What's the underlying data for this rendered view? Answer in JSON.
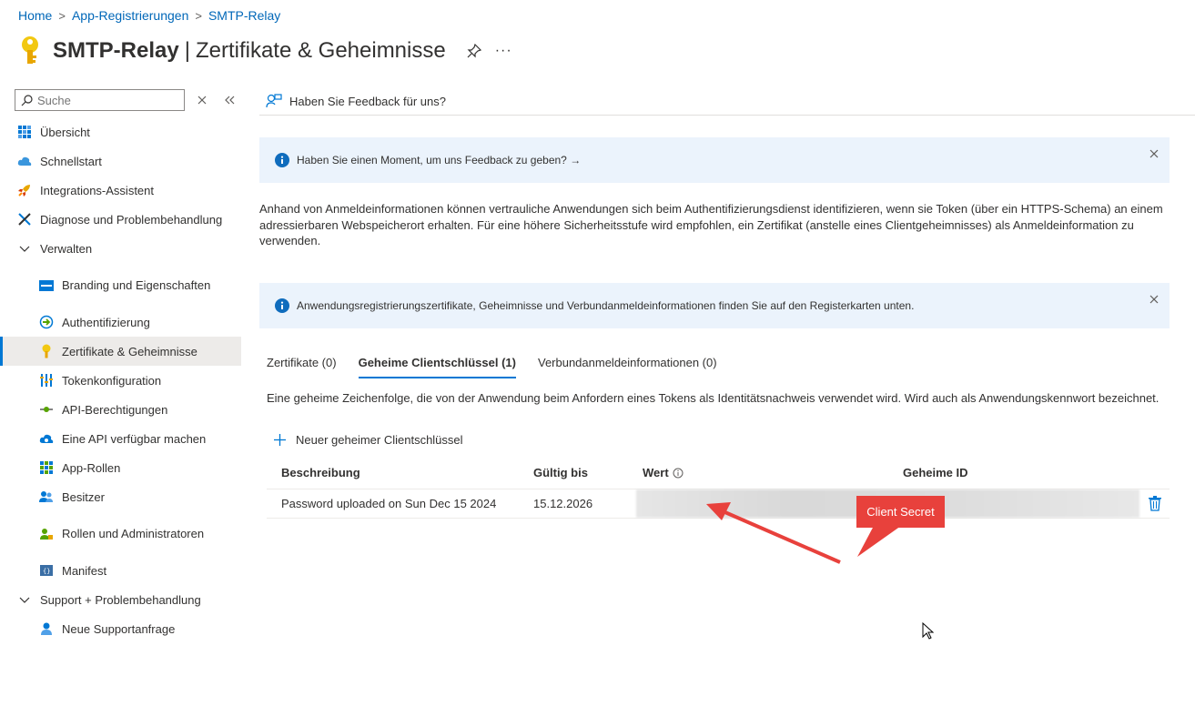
{
  "breadcrumb": {
    "home": "Home",
    "app_reg": "App-Registrierungen",
    "current": "SMTP-Relay"
  },
  "title": {
    "name": "SMTP-Relay",
    "separator": "|",
    "section": "Zertifikate & Geheimnisse",
    "more": "···"
  },
  "sidebar": {
    "search_placeholder": "Suche",
    "items": [
      {
        "label": "Übersicht",
        "icon": "grid-icon"
      },
      {
        "label": "Schnellstart",
        "icon": "cloud-icon"
      },
      {
        "label": "Integrations-Assistent",
        "icon": "rocket-icon"
      },
      {
        "label": "Diagnose und Problembehandlung",
        "icon": "wrench-icon"
      },
      {
        "label": "Verwalten",
        "icon": "chevron-down-icon"
      },
      {
        "label": "Branding und Eigenschaften",
        "icon": "branding-icon"
      },
      {
        "label": "Authentifizierung",
        "icon": "auth-icon"
      },
      {
        "label": "Zertifikate & Geheimnisse",
        "icon": "key-icon"
      },
      {
        "label": "Tokenkonfiguration",
        "icon": "token-icon"
      },
      {
        "label": "API-Berechtigungen",
        "icon": "api-perm-icon"
      },
      {
        "label": "Eine API verfügbar machen",
        "icon": "cloud-api-icon"
      },
      {
        "label": "App-Rollen",
        "icon": "app-roles-icon"
      },
      {
        "label": "Besitzer",
        "icon": "owners-icon"
      },
      {
        "label": "Rollen und Administratoren",
        "icon": "roles-admin-icon"
      },
      {
        "label": "Manifest",
        "icon": "manifest-icon"
      },
      {
        "label": "Support + Problembehandlung",
        "icon": "chevron-down-icon"
      },
      {
        "label": "Neue Supportanfrage",
        "icon": "support-icon"
      }
    ]
  },
  "toolbar": {
    "feedback": "Haben Sie Feedback für uns?"
  },
  "banner1": {
    "text": "Haben Sie einen Moment, um uns Feedback zu geben?",
    "arrow": "→"
  },
  "description": "Anhand von Anmeldeinformationen können vertrauliche Anwendungen sich beim Authentifizierungsdienst identifizieren, wenn sie Token (über ein HTTPS-Schema) an einem adressierbaren Webspeicherort erhalten. Für eine höhere Sicherheitsstufe wird empfohlen, ein Zertifikat (anstelle eines Clientgeheimnisses) als Anmeldeinformation zu verwenden.",
  "banner2": {
    "text": "Anwendungsregistrierungszertifikate, Geheimnisse und Verbundanmeldeinformationen finden Sie auf den Registerkarten unten."
  },
  "tabs": [
    "Zertifikate (0)",
    "Geheime Clientschlüssel (1)",
    "Verbundanmeldeinformationen (0)"
  ],
  "tab_description": "Eine geheime Zeichenfolge, die von der Anwendung beim Anfordern eines Tokens als Identitätsnachweis verwendet wird. Wird auch als Anwendungskennwort bezeichnet.",
  "add_button": "Neuer geheimer Clientschlüssel",
  "table": {
    "headers": {
      "description": "Beschreibung",
      "expires": "Gültig bis",
      "value": "Wert",
      "secret_id": "Geheime ID"
    },
    "rows": [
      {
        "description": "Password uploaded on Sun Dec 15 2024",
        "expires": "15.12.2026"
      }
    ]
  },
  "annotation": {
    "label": "Client Secret",
    "color": "#e8413c"
  },
  "colors": {
    "accent": "#0078d4",
    "link": "#0067b8",
    "banner_bg": "#ebf3fc"
  }
}
